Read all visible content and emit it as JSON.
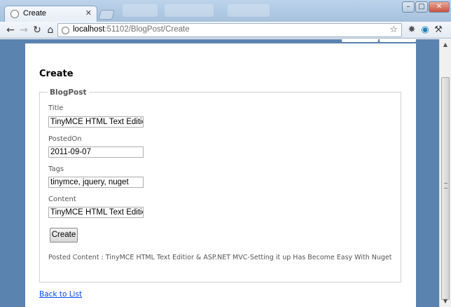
{
  "browser": {
    "tab_title": "Create",
    "tab_close": "✕",
    "url_host": "localhost",
    "url_rest": ":51102/BlogPost/Create",
    "back": "←",
    "forward": "→",
    "reload": "↻",
    "home": "⌂",
    "star": "☆",
    "min": "–",
    "max": "□",
    "close": "✕"
  },
  "page": {
    "title": "Create",
    "legend": "BlogPost",
    "fields": [
      {
        "label": "Title",
        "value": "TinyMCE HTML Text Editior &"
      },
      {
        "label": "PostedOn",
        "value": "2011-09-07"
      },
      {
        "label": "Tags",
        "value": "tinymce, jquery, nuget"
      },
      {
        "label": "Content",
        "value": "TinyMCE HTML Text Editior &"
      }
    ],
    "create_button": "Create",
    "posted_content": "Posted Content : TinyMCE HTML Text Editior & ASP.NET MVC-Setting it up Has Become Easy With Nuget",
    "back_link": "Back to List"
  },
  "colors": {
    "page_background": "#5b83b0",
    "link": "#034af3"
  },
  "icons": {
    "tab": "favicon-icon",
    "omnibox": "page-icon",
    "toolbar": [
      "extension-icon",
      "chrome-icon",
      "wrench-icon"
    ]
  }
}
